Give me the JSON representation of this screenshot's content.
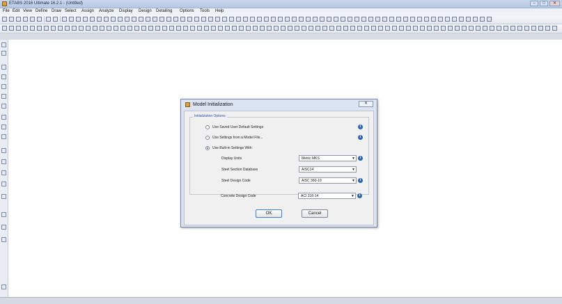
{
  "window": {
    "title": "ETABS 2016 Ultimate 16.2.1 - (Untitled)",
    "minimize_label": "–",
    "maximize_label": "□",
    "close_label": "✕"
  },
  "menu": [
    {
      "label": "File"
    },
    {
      "label": "Edit"
    },
    {
      "label": "View"
    },
    {
      "label": "Define"
    },
    {
      "label": "Draw"
    },
    {
      "label": "Select"
    },
    {
      "label": "Assign"
    },
    {
      "label": "Analyze"
    },
    {
      "label": "Display"
    },
    {
      "label": "Design"
    },
    {
      "label": "Detailing"
    },
    {
      "label": "Options"
    },
    {
      "label": "Tools"
    },
    {
      "label": "Help"
    }
  ],
  "dialog": {
    "title": "Model Initialization",
    "close_label": "✕",
    "group_title": "Initialization Options",
    "options": [
      {
        "label": "Use Saved User Default Settings",
        "selected": false
      },
      {
        "label": "Use Settings from a Model File...",
        "selected": false
      },
      {
        "label": "Use Built-in Settings With:",
        "selected": true
      }
    ],
    "fields": [
      {
        "label": "Display Units",
        "value": "Metric MKS",
        "info": true
      },
      {
        "label": "Steel Section Database",
        "value": "AISC14",
        "info": false
      },
      {
        "label": "Steel Design Code",
        "value": "AISC 360-10",
        "info": true
      },
      {
        "label": "Concrete Design Code",
        "value": "ACI 318-14",
        "info": true
      }
    ],
    "ok_label": "OK",
    "cancel_label": "Cancel",
    "info_glyph": "i"
  },
  "icons": {
    "app": "etabs-app-icon",
    "info": "info-icon",
    "dropdown": "chevron-down-icon"
  },
  "colors": {
    "accent": "#2d63b5",
    "group_title": "#2a52a8",
    "workspace": "#ffffff"
  }
}
